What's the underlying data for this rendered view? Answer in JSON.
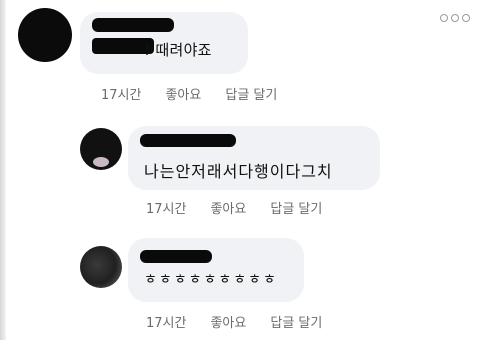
{
  "comments": [
    {
      "text": "! 때려야죠",
      "time": "17시간",
      "like_label": "좋아요",
      "reply_label": "답글 달기"
    },
    {
      "text": "나는안저래서다행이다그치",
      "time": "17시간",
      "like_label": "좋아요",
      "reply_label": "답글 달기"
    },
    {
      "text": "ㅎㅎㅎㅎㅎㅎㅎㅎㅎ",
      "time": "17시간",
      "like_label": "좋아요",
      "reply_label": "답글 달기"
    }
  ],
  "icons": {
    "more": "more-options-icon",
    "avatar": "user-avatar"
  },
  "colors": {
    "bubble_bg": "#f0f2f5",
    "meta_text": "#6b6b6b",
    "redaction": "#0a0a0a"
  }
}
